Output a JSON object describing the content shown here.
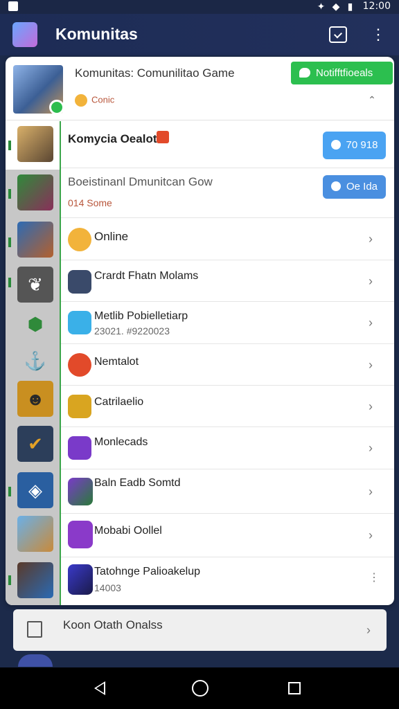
{
  "status_bar": {
    "time": "12:00"
  },
  "app_bar": {
    "title": "Komunitas"
  },
  "header": {
    "name": "Komunitas: Comunilitao Game",
    "subtitle": "Conic",
    "notify_button": "Notifftfioeals"
  },
  "rows": [
    {
      "label": "Komycia Oealot",
      "pill": "70 918",
      "pill_color": "#4aa3f2"
    },
    {
      "label": "Boeistinanl Dmunitcan Gow",
      "sub": "014 Some",
      "pill": "Oe Ida",
      "pill_color": "#4a8fe0"
    },
    {
      "label": "Online"
    },
    {
      "label": "Crardt Fhatn Molams"
    },
    {
      "label": "Metlib Pobielletiarp",
      "sub": "23021. #9220023"
    },
    {
      "label": "Nemtalot"
    },
    {
      "label": "Catrilaelio"
    },
    {
      "label": "Monlecads"
    },
    {
      "label": "Baln Eadb Somtd"
    },
    {
      "label": "Mobabi Oollel"
    },
    {
      "label": "Tatohnge Palioakelup",
      "sub": "14003"
    }
  ],
  "bottom_card": {
    "label": "Koon Otath Onalss"
  },
  "colors": {
    "app_bar": "#1d2c55",
    "notify_green": "#2cbf4f",
    "rail_grey": "#c7c7c7",
    "accent_green": "#3aa54a"
  },
  "icons": {
    "row_icons": [
      "hero-avatar-icon",
      "status-pill-icon",
      "smile-icon",
      "treasure-chest-icon",
      "ice-cube-icon",
      "red-orb-icon",
      "gold-trophy-icon",
      "purple-gem-icon",
      "hero-portrait-icon",
      "purple-orb-icon",
      "purple-sword-icon"
    ]
  }
}
